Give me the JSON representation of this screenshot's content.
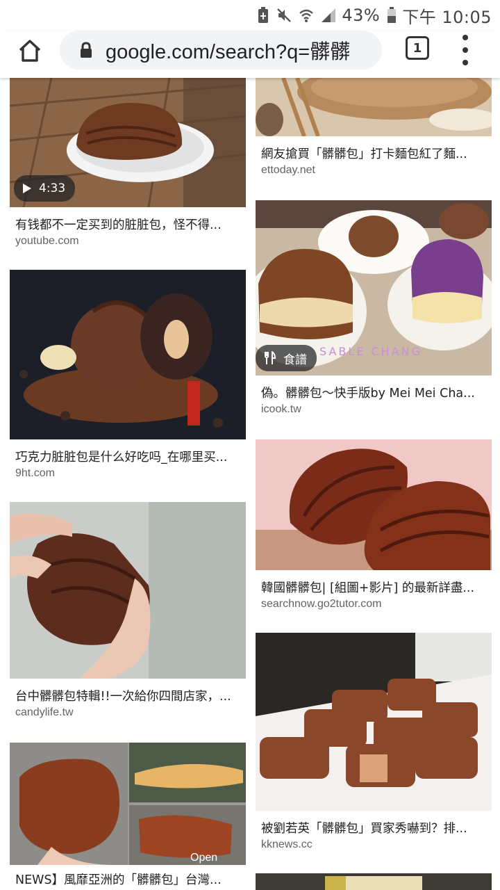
{
  "status_bar": {
    "battery": "43%",
    "time": "下午 10:05"
  },
  "address_bar": {
    "url": "google.com/search?q=髒髒",
    "tab_count": "1"
  },
  "results": {
    "left": [
      {
        "title": "有钱都不一定买到的脏脏包，怪不得...",
        "domain": "youtube.com",
        "badge": "4:33"
      },
      {
        "title": "巧克力脏脏包是什么好吃吗_在哪里买...",
        "domain": "9ht.com"
      },
      {
        "title": "台中髒髒包特輯!!一次給你四間店家，...",
        "domain": "candylife.tw"
      },
      {
        "title": "NEWS】風靡亞洲的「髒髒包」台灣...",
        "domain": ""
      }
    ],
    "right": [
      {
        "title": "網友搶買「髒髒包」打卡麵包紅了麵...",
        "domain": "ettoday.net"
      },
      {
        "title": "偽。髒髒包～快手版by Mei Mei Cha...",
        "domain": "icook.tw",
        "badge": "食譜",
        "watermark": "SABLE CHANG"
      },
      {
        "title": "韓國髒髒包| [組圖+影片] 的最新詳盡...",
        "domain": "searchnow.go2tutor.com"
      },
      {
        "title": "被劉若英「髒髒包」買家秀嚇到？排...",
        "domain": "kknews.cc"
      }
    ]
  },
  "colors": {
    "omnibox_bg": "#f1f3f4",
    "domain_text": "#5f6368",
    "title_text": "#202124"
  }
}
